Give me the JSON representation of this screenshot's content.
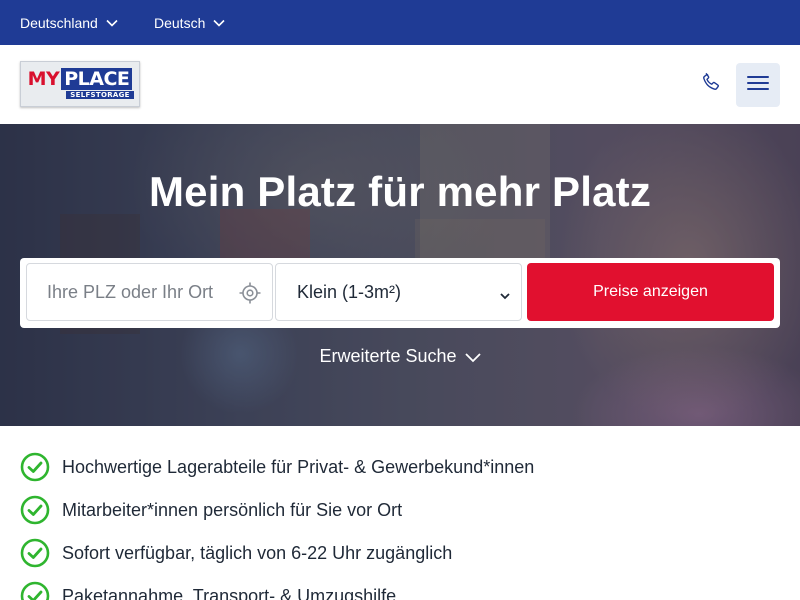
{
  "topbar": {
    "country_label": "Deutschland",
    "language_label": "Deutsch"
  },
  "header": {
    "logo": {
      "main_my": "MY",
      "main_place": "PLACE",
      "sub": "SELFSTORAGE"
    },
    "phone_icon": "phone-icon",
    "menu_icon": "hamburger-menu-icon"
  },
  "hero": {
    "title": "Mein Platz für mehr Platz",
    "search": {
      "location_placeholder": "Ihre PLZ oder Ihr Ort",
      "location_value": "",
      "size_selected": "Klein (1-3m²)",
      "submit_label": "Preise anzeigen"
    },
    "advanced_search_label": "Erweiterte Suche"
  },
  "benefits": [
    "Hochwertige Lagerabteile für Privat- & Gewerbekund*innen",
    "Mitarbeiter*innen persönlich für Sie vor Ort",
    "Sofort verfügbar, täglich von 6-22 Uhr zugänglich",
    "Paketannahme, Transport- & Umzugshilfe"
  ],
  "colors": {
    "topbar": "#1f3b95",
    "accent_red": "#e1102f",
    "check_green": "#2fb52f",
    "menu_bg": "#e6ecf5"
  }
}
